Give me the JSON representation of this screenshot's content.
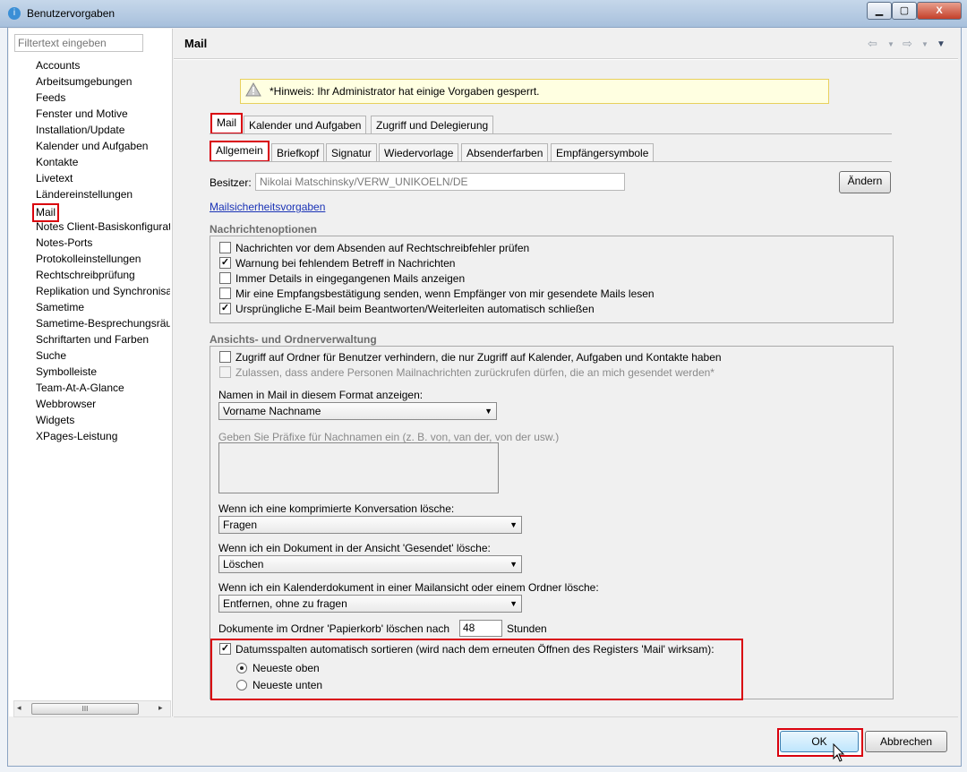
{
  "window": {
    "title": "Benutzervorgaben",
    "min_label": "0",
    "max_label": "1",
    "close_label": "X"
  },
  "filter": {
    "placeholder": "Filtertext eingeben"
  },
  "sidebar": {
    "items": [
      {
        "label": "Accounts"
      },
      {
        "label": "Arbeitsumgebungen"
      },
      {
        "label": "Feeds"
      },
      {
        "label": "Fenster und Motive"
      },
      {
        "label": "Installation/Update"
      },
      {
        "label": "Kalender und Aufgaben"
      },
      {
        "label": "Kontakte"
      },
      {
        "label": "Livetext"
      },
      {
        "label": "Ländereinstellungen"
      },
      {
        "label": "Mail",
        "selected": true
      },
      {
        "label": "Notes Client-Basiskonfigurat"
      },
      {
        "label": "Notes-Ports"
      },
      {
        "label": "Protokolleinstellungen"
      },
      {
        "label": "Rechtschreibprüfung"
      },
      {
        "label": "Replikation und Synchronisa"
      },
      {
        "label": "Sametime"
      },
      {
        "label": "Sametime-Besprechungsräu"
      },
      {
        "label": "Schriftarten und Farben"
      },
      {
        "label": "Suche"
      },
      {
        "label": "Symbolleiste"
      },
      {
        "label": "Team-At-A-Glance"
      },
      {
        "label": "Webbrowser"
      },
      {
        "label": "Widgets"
      },
      {
        "label": "XPages-Leistung"
      }
    ]
  },
  "page": {
    "title": "Mail",
    "hint": "*Hinweis: Ihr Administrator hat einige Vorgaben gesperrt.",
    "tabs": [
      {
        "label": "Mail",
        "active": true
      },
      {
        "label": "Kalender und Aufgaben"
      },
      {
        "label": "Zugriff und Delegierung"
      }
    ],
    "subtabs": [
      {
        "label": "Allgemein",
        "active": true
      },
      {
        "label": "Briefkopf"
      },
      {
        "label": "Signatur"
      },
      {
        "label": "Wiedervorlage"
      },
      {
        "label": "Absenderfarben"
      },
      {
        "label": "Empfängersymbole"
      }
    ],
    "owner_label": "Besitzer:",
    "owner_value": "Nikolai Matschinsky/VERW_UNIKOELN/DE",
    "change_button": "Ändern",
    "security_link": "Mailsicherheitsvorgaben"
  },
  "message_options": {
    "header": "Nachrichtenoptionen",
    "items": [
      {
        "label": "Nachrichten vor dem Absenden auf Rechtschreibfehler prüfen",
        "checked": false
      },
      {
        "label": "Warnung bei fehlendem Betreff in Nachrichten",
        "checked": true
      },
      {
        "label": "Immer Details in eingegangenen Mails anzeigen",
        "checked": false
      },
      {
        "label": "Mir eine Empfangsbestätigung senden, wenn Empfänger von mir gesendete Mails lesen",
        "checked": false
      },
      {
        "label": "Ursprüngliche E-Mail beim Beantworten/Weiterleiten automatisch schließen",
        "checked": true
      }
    ]
  },
  "view_options": {
    "header": "Ansichts- und Ordnerverwaltung",
    "block_access": {
      "label": "Zugriff auf Ordner für Benutzer verhindern, die nur Zugriff auf Kalender, Aufgaben und Kontakte haben",
      "checked": false
    },
    "allow_recall": {
      "label": "Zulassen, dass andere Personen Mailnachrichten zurückrufen dürfen, die an mich gesendet werden*",
      "checked": false,
      "disabled": true
    },
    "name_format_label": "Namen in Mail in diesem Format anzeigen:",
    "name_format_value": "Vorname Nachname",
    "prefix_label": "Geben Sie Präfixe für Nachnamen ein (z. B. von, van der, von der usw.)",
    "collapsed_label": "Wenn ich eine komprimierte Konversation lösche:",
    "collapsed_value": "Fragen",
    "sent_label": "Wenn ich ein Dokument in der Ansicht 'Gesendet' lösche:",
    "sent_value": "Löschen",
    "calendar_label": "Wenn ich ein Kalenderdokument in einer Mailansicht oder einem Ordner lösche:",
    "calendar_value": "Entfernen, ohne zu fragen",
    "trash_label": "Dokumente im Ordner 'Papierkorb' löschen nach",
    "trash_days": "48",
    "trash_unit": "Stunden",
    "sort_label": "Datumsspalten automatisch sortieren (wird nach dem erneuten Öffnen des Registers 'Mail' wirksam):",
    "sort_checked": true,
    "newest_top": "Neueste oben",
    "newest_bottom": "Neueste unten",
    "newest_selected": "top"
  },
  "footer": {
    "ok": "OK",
    "cancel": "Abbrechen"
  },
  "scrollbar": {
    "thumb_label": "III"
  },
  "icons": [
    "app-icon",
    "warning-icon",
    "back-arrow-icon",
    "forward-arrow-icon",
    "dropdown-arrow-icon",
    "mouse-cursor-icon"
  ]
}
